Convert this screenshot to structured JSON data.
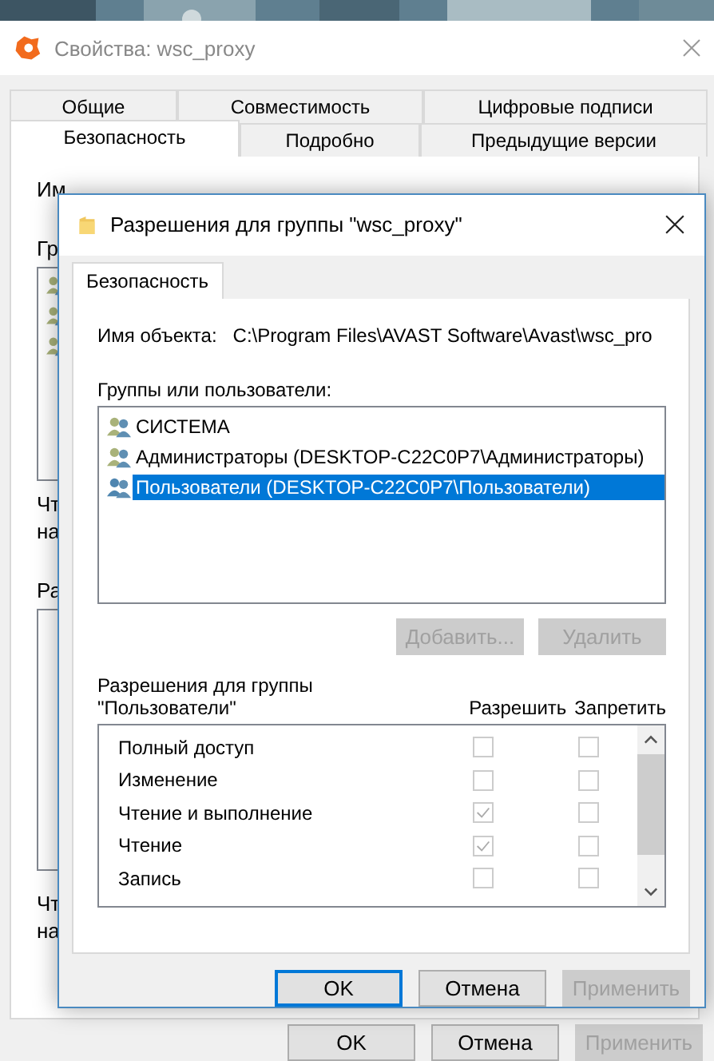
{
  "back_window": {
    "title": "Свойства: wsc_proxy",
    "tab_rows": [
      [
        {
          "label": "Общие",
          "selected": false
        },
        {
          "label": "Совместимость",
          "selected": false
        },
        {
          "label": "Цифровые подписи",
          "selected": false
        }
      ],
      [
        {
          "label": "Безопасность",
          "selected": true
        },
        {
          "label": "Подробно",
          "selected": false
        },
        {
          "label": "Предыдущие версии",
          "selected": false
        }
      ]
    ],
    "fragments": [
      "Им",
      "Гр"
    ],
    "fragments_2": [
      "Чт",
      "на",
      "Ра"
    ],
    "fragments_3": [
      "Чт",
      "на"
    ],
    "buttons": [
      {
        "label": "OK",
        "disabled": false
      },
      {
        "label": "Отмена",
        "disabled": false
      },
      {
        "label": "Применить",
        "disabled": true
      }
    ]
  },
  "dialog": {
    "title": "Разрешения для группы \"wsc_proxy\"",
    "tabs": [
      {
        "label": "Безопасность",
        "selected": true
      }
    ],
    "object_label": "Имя объекта:",
    "object_value": "C:\\Program Files\\AVAST Software\\Avast\\wsc_pro",
    "groups_label": "Группы или пользователи:",
    "groups": [
      {
        "label": "СИСТЕМА",
        "selected": false
      },
      {
        "label": "Администраторы (DESKTOP-C22C0P7\\Администраторы)",
        "selected": false
      },
      {
        "label": "Пользователи (DESKTOP-C22C0P7\\Пользователи)",
        "selected": true
      }
    ],
    "group_buttons": [
      {
        "label": "Добавить...",
        "disabled": true
      },
      {
        "label": "Удалить",
        "disabled": true
      }
    ],
    "permissions_label": "Разрешения для группы\n\"Пользователи\"",
    "allow_header": "Разрешить",
    "deny_header": "Запретить",
    "permissions": [
      {
        "name": "Полный доступ",
        "allow": false,
        "deny": false,
        "disabled": true
      },
      {
        "name": "Изменение",
        "allow": false,
        "deny": false,
        "disabled": true
      },
      {
        "name": "Чтение и выполнение",
        "allow": true,
        "deny": false,
        "disabled": true
      },
      {
        "name": "Чтение",
        "allow": true,
        "deny": false,
        "disabled": true
      },
      {
        "name": "Запись",
        "allow": false,
        "deny": false,
        "disabled": true
      }
    ],
    "buttons": [
      {
        "label": "OK",
        "disabled": false,
        "focused": true
      },
      {
        "label": "Отмена",
        "disabled": false,
        "focused": false
      },
      {
        "label": "Применить",
        "disabled": true,
        "focused": false
      }
    ]
  }
}
